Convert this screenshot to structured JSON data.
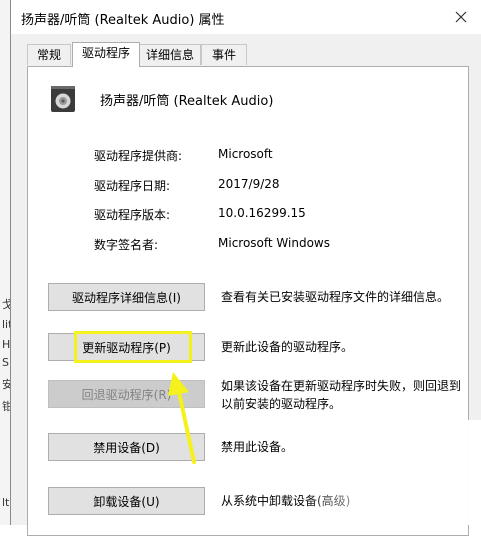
{
  "window": {
    "title": "扬声器/听筒 (Realtek Audio) 属性",
    "close_label": "✕"
  },
  "tabs": [
    {
      "label": "常规",
      "active": false
    },
    {
      "label": "驱动程序",
      "active": true
    },
    {
      "label": "详细信息",
      "active": false
    },
    {
      "label": "事件",
      "active": false
    }
  ],
  "device": {
    "name": "扬声器/听筒 (Realtek Audio)",
    "icon": "speaker-icon"
  },
  "driver_info": {
    "provider_label": "驱动程序提供商:",
    "provider_value": "Microsoft",
    "date_label": "驱动程序日期:",
    "date_value": "2017/9/28",
    "version_label": "驱动程序版本:",
    "version_value": "10.0.16299.15",
    "signer_label": "数字签名者:",
    "signer_value": "Microsoft Windows"
  },
  "actions": {
    "details_button": "驱动程序详细信息(I)",
    "details_desc": "查看有关已安装驱动程序文件的详细信息。",
    "update_button": "更新驱动程序(P)",
    "update_desc": "更新此设备的驱动程序。",
    "rollback_button": "回退驱动程序(R)",
    "rollback_desc_line1": "如果该设备在更新驱动程序时失败，则回退到",
    "rollback_desc_line2": "以前安装的驱动程序。",
    "disable_button": "禁用设备(D)",
    "disable_desc": "禁用此设备。",
    "uninstall_button": "卸载设备(U)",
    "uninstall_desc": "从系统中卸载设备(高级)"
  },
  "background_fragments": [
    "戈",
    "lit",
    "H",
    "S",
    "安",
    "钳",
    "lt"
  ],
  "colors": {
    "highlight": "#f4f11c",
    "arrow": "#f4f11c"
  }
}
